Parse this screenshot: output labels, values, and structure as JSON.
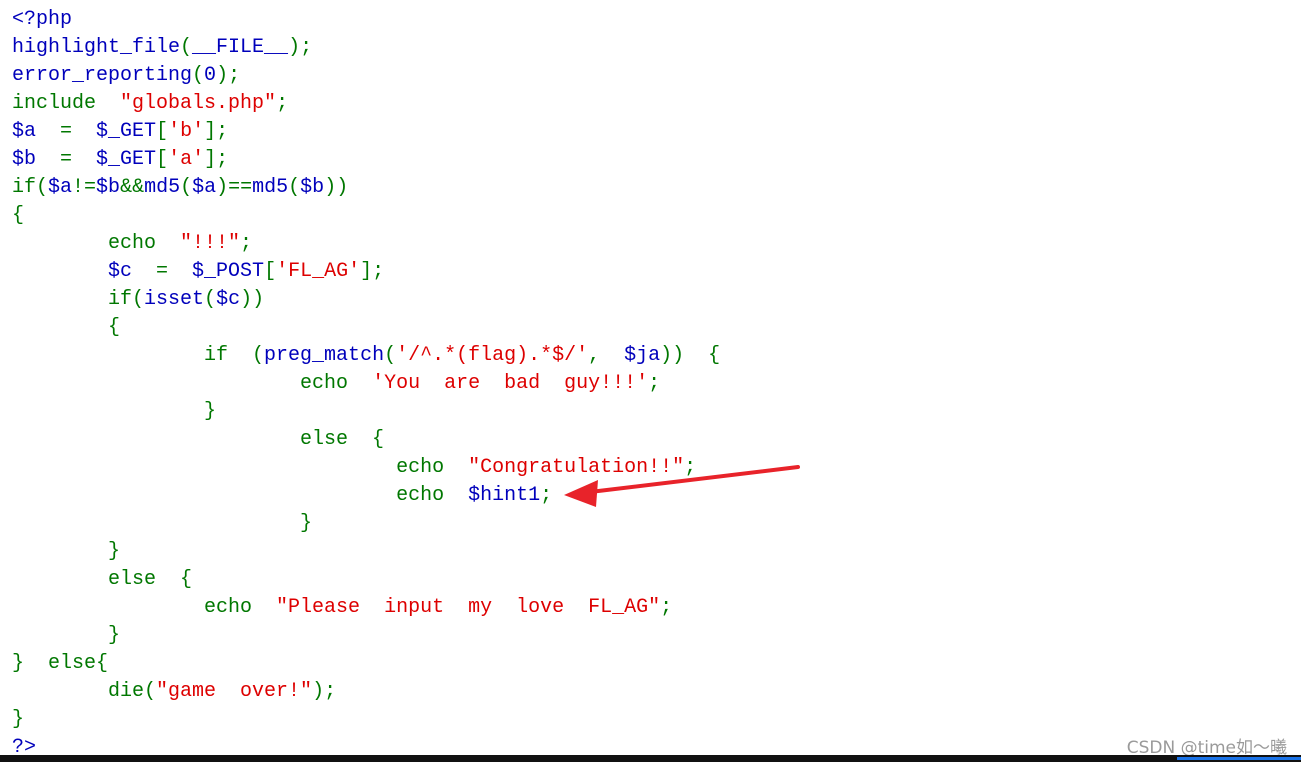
{
  "colors": {
    "keyword": "#007700",
    "default": "#0000BB",
    "string": "#DD0000",
    "annotation_arrow": "#e8232a"
  },
  "code_lines": [
    [
      [
        "<?php",
        "d"
      ]
    ],
    [
      [
        "highlight_file",
        "d"
      ],
      [
        "(",
        "k"
      ],
      [
        "__FILE__",
        "d"
      ],
      [
        ");",
        "k"
      ]
    ],
    [
      [
        "error_reporting",
        "d"
      ],
      [
        "(",
        "k"
      ],
      [
        "0",
        "d"
      ],
      [
        ");",
        "k"
      ]
    ],
    [
      [
        "include  ",
        "k"
      ],
      [
        "\"globals.php\"",
        "s"
      ],
      [
        ";",
        "k"
      ]
    ],
    [
      [
        "$a",
        "d"
      ],
      [
        "  =  ",
        "k"
      ],
      [
        "$_GET",
        "d"
      ],
      [
        "[",
        "k"
      ],
      [
        "'b'",
        "s"
      ],
      [
        "];",
        "k"
      ]
    ],
    [
      [
        "$b",
        "d"
      ],
      [
        "  =  ",
        "k"
      ],
      [
        "$_GET",
        "d"
      ],
      [
        "[",
        "k"
      ],
      [
        "'a'",
        "s"
      ],
      [
        "];",
        "k"
      ]
    ],
    [
      [
        "if(",
        "k"
      ],
      [
        "$a",
        "d"
      ],
      [
        "!=",
        "k"
      ],
      [
        "$b",
        "d"
      ],
      [
        "&&",
        "k"
      ],
      [
        "md5",
        "d"
      ],
      [
        "(",
        "k"
      ],
      [
        "$a",
        "d"
      ],
      [
        ")==",
        "k"
      ],
      [
        "md5",
        "d"
      ],
      [
        "(",
        "k"
      ],
      [
        "$b",
        "d"
      ],
      [
        "))",
        "k"
      ]
    ],
    [
      [
        "{",
        "k"
      ]
    ],
    [
      [
        "        echo  ",
        "k"
      ],
      [
        "\"!!!\"",
        "s"
      ],
      [
        ";",
        "k"
      ]
    ],
    [
      [
        "        ",
        "k"
      ],
      [
        "$c",
        "d"
      ],
      [
        "  =  ",
        "k"
      ],
      [
        "$_POST",
        "d"
      ],
      [
        "[",
        "k"
      ],
      [
        "'FL_AG'",
        "s"
      ],
      [
        "];",
        "k"
      ]
    ],
    [
      [
        "        if(",
        "k"
      ],
      [
        "isset",
        "d"
      ],
      [
        "(",
        "k"
      ],
      [
        "$c",
        "d"
      ],
      [
        "))",
        "k"
      ]
    ],
    [
      [
        "        {",
        "k"
      ]
    ],
    [
      [
        "                if  (",
        "k"
      ],
      [
        "preg_match",
        "d"
      ],
      [
        "(",
        "k"
      ],
      [
        "'/^.*(flag).*$/'",
        "s"
      ],
      [
        ",  ",
        "k"
      ],
      [
        "$ja",
        "d"
      ],
      [
        "))  {",
        "k"
      ]
    ],
    [
      [
        "                        echo  ",
        "k"
      ],
      [
        "'You  are  bad  guy!!!'",
        "s"
      ],
      [
        ";",
        "k"
      ]
    ],
    [
      [
        "                }",
        "k"
      ]
    ],
    [
      [
        "                        else  {",
        "k"
      ]
    ],
    [
      [
        "                                echo  ",
        "k"
      ],
      [
        "\"Congratulation!!\"",
        "s"
      ],
      [
        ";",
        "k"
      ]
    ],
    [
      [
        "                                echo  ",
        "k"
      ],
      [
        "$hint1",
        "d"
      ],
      [
        ";",
        "k"
      ]
    ],
    [
      [
        "                        }",
        "k"
      ]
    ],
    [
      [
        "        }",
        "k"
      ]
    ],
    [
      [
        "        else  {",
        "k"
      ]
    ],
    [
      [
        "                echo  ",
        "k"
      ],
      [
        "\"Please  input  my  love  FL_AG\"",
        "s"
      ],
      [
        ";",
        "k"
      ]
    ],
    [
      [
        "        }",
        "k"
      ]
    ],
    [
      [
        "}  else{",
        "k"
      ]
    ],
    [
      [
        "        die(",
        "k"
      ],
      [
        "\"game  over!\"",
        "s"
      ],
      [
        ");",
        "k"
      ]
    ],
    [
      [
        "}",
        "k"
      ]
    ],
    [
      [
        "?>",
        "d"
      ]
    ]
  ],
  "watermark": "CSDN @time如～曦"
}
